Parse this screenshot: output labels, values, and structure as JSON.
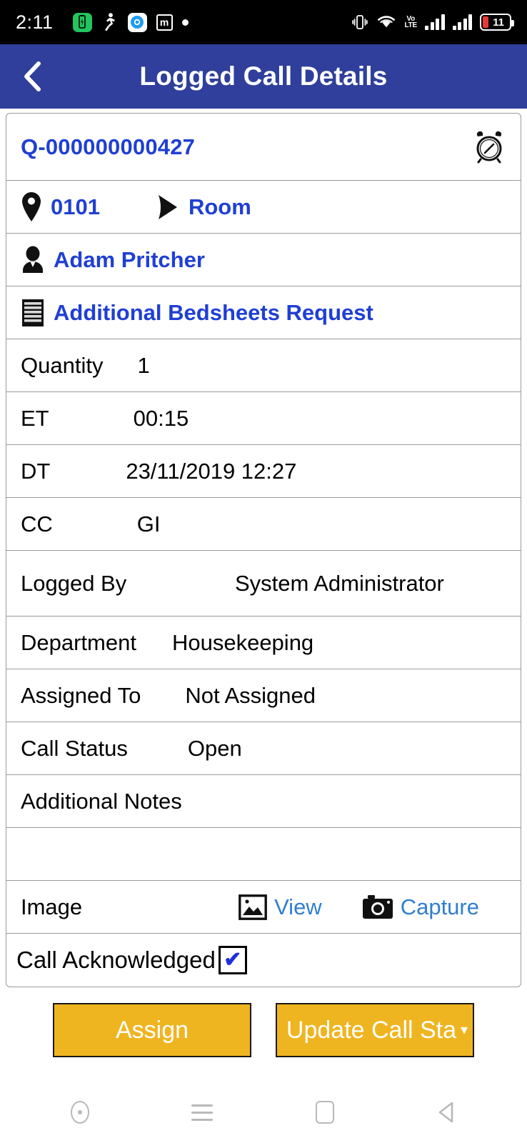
{
  "status_bar": {
    "time": "2:11",
    "battery_percent": "11",
    "icons_left": [
      "battery-charging-icon",
      "walking-icon",
      "app-circle-icon",
      "app-m-icon",
      "dot-icon"
    ],
    "icons_right": [
      "vibrate-icon",
      "wifi-icon",
      "volte-icon",
      "signal-sim1-icon",
      "signal-sim2-icon",
      "battery-icon"
    ],
    "volte_top": "Vo",
    "volte_bottom": "LTE",
    "app_m_label": "m"
  },
  "app_bar": {
    "title": "Logged Call Details",
    "back_icon": "chevron-left-icon"
  },
  "details": {
    "ticket_id": "Q-000000000427",
    "alarm_icon": "alarm-clock-icon",
    "location_code": "0101",
    "location_type": "Room",
    "guest_name": "Adam Pritcher",
    "request_title": "Additional Bedsheets Request"
  },
  "fields": [
    {
      "label": "Quantity",
      "value": "1"
    },
    {
      "label": "ET",
      "value": "00:15"
    },
    {
      "label": "DT",
      "value": "23/11/2019 12:27"
    },
    {
      "label": "CC",
      "value": "GI"
    },
    {
      "label": "Logged By",
      "value": "System Administrator"
    },
    {
      "label": "Department",
      "value": "Housekeeping"
    },
    {
      "label": "Assigned To",
      "value": "Not Assigned"
    },
    {
      "label": "Call Status",
      "value": "Open"
    },
    {
      "label": "Additional Notes",
      "value": ""
    }
  ],
  "image_row": {
    "label": "Image",
    "view_label": "View",
    "capture_label": "Capture",
    "view_icon": "photo-icon",
    "capture_icon": "camera-icon"
  },
  "acknowledge_row": {
    "label": "Call Acknowledged",
    "checked": true,
    "check_glyph": "✔"
  },
  "buttons": {
    "assign": "Assign",
    "update_status": "Update Call Sta",
    "update_caret": "▾"
  },
  "nav_bar": {
    "items": [
      "assistant-icon",
      "menu-icon",
      "recents-icon",
      "back-icon"
    ]
  },
  "colors": {
    "app_bar": "#2f3f9b",
    "link": "#1f3fd4",
    "action_link": "#2f7fd0",
    "button": "#efb520",
    "check": "#1f2fe0",
    "battery_red": "#e53935",
    "battery_green": "#22c55e"
  }
}
